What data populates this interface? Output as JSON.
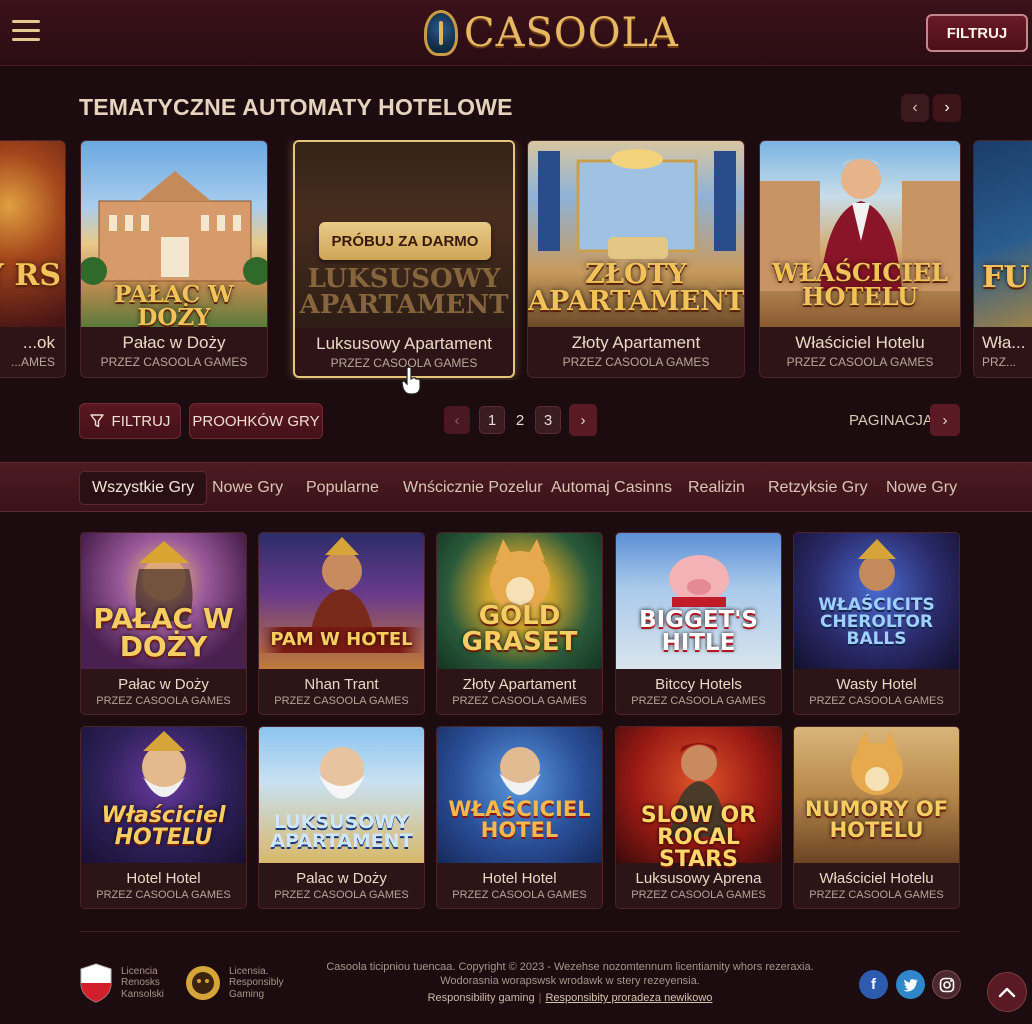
{
  "header": {
    "logo_text": "CASOOLA",
    "filter_label": "FILTRUJ"
  },
  "section": {
    "title": "TEMATYCZNE AUTOMATY HOTELOWE"
  },
  "carousel": {
    "try_label": "PRÓBUJ ZA DARMO",
    "items": [
      {
        "art": "WY RS",
        "name": "...ok",
        "by": "...AMES"
      },
      {
        "art": "PAŁAC W DOŻY",
        "name": "Pałac w Doży",
        "by": "PRZEZ CASOOLA GAMES"
      },
      {
        "art": "LUKSUSOWY APARTAMENT",
        "name": "Luksusowy Apartament",
        "by": "PRZEZ CASOOLA GAMES"
      },
      {
        "art": "ZŁOTY APARTAMENT",
        "name": "Złoty Apartament",
        "by": "PRZEZ CASOOLA GAMES"
      },
      {
        "art": "WŁAŚCICIEL HOTELU",
        "name": "Właściciel Hotelu",
        "by": "PRZEZ CASOOLA GAMES"
      },
      {
        "art": "FU S",
        "name": "Wła...",
        "by": "PRZ..."
      }
    ]
  },
  "controls": {
    "filter_label": "FILTRUJ",
    "providers_label": "PROOHKÓW GRY",
    "pages": [
      "1",
      "2",
      "3"
    ],
    "pagination_label": "PAGINACJA"
  },
  "categories": [
    "Wszystkie Gry",
    "Nowe Gry",
    "Popularne",
    "Wnścicznie Pozelur",
    "Automaj Casinns",
    "Realizin",
    "Retzyksie Gry",
    "Nowe Gry"
  ],
  "games": [
    {
      "art": "PAŁAC W DOŻY",
      "name": "Pałac w Doży",
      "by": "PRZEZ CASOOLA GAMES"
    },
    {
      "art": "PAM W HOTEL",
      "name": "Nhan Trant",
      "by": "PRZEZ CASOOLA GAMES"
    },
    {
      "art": "GOLD GRASET",
      "name": "Złoty Apartament",
      "by": "PRZEZ CASOOLA GAMES"
    },
    {
      "art": "BIGGET'S HITLE",
      "name": "Bitccy Hotels",
      "by": "PRZEZ CASOOLA GAMES"
    },
    {
      "art": "WŁAŚCICITS CHEROLTOR BALLS",
      "name": "Wasty Hotel",
      "by": "PRZEZ CASOOLA GAMES"
    },
    {
      "art": "Właściciel HOTELU",
      "name": "Hotel Hotel",
      "by": "PRZEZ CASOOLA GAMES"
    },
    {
      "art": "LUKSUSOWY APARTAMENT",
      "name": "Palac w Doży",
      "by": "PRZEZ CASOOLA GAMES"
    },
    {
      "art": "WŁAŚCICIEL HOTEL",
      "name": "Hotel Hotel",
      "by": "PRZEZ CASOOLA GAMES"
    },
    {
      "art": "SLOW OR ROCAL STARS",
      "name": "Luksusowy Aprena",
      "by": "PRZEZ CASOOLA GAMES"
    },
    {
      "art": "NUMORY OF HOTELU",
      "name": "Właściciel Hotelu",
      "by": "PRZEZ CASOOLA GAMES"
    }
  ],
  "footer": {
    "badge1": "Licencia Renosks Kansolski",
    "badge2": "Licensia. Responsibly Gaming",
    "copyright_line1": "Casoola ticipniou tuencaa. Copyright © 2023 - Wezehse nozomtennum licentiamity whors rezeraxia.",
    "copyright_line2": "Wodorasnia worapswsk wrodawk w stery rezeyensia.",
    "link1": "Responsibility gaming",
    "link2": "Responsibity proradeza newikowo"
  },
  "colors": {
    "background": "#1d0c0f",
    "accent_gold": "#e6b864",
    "button_red": "#5a1821"
  }
}
